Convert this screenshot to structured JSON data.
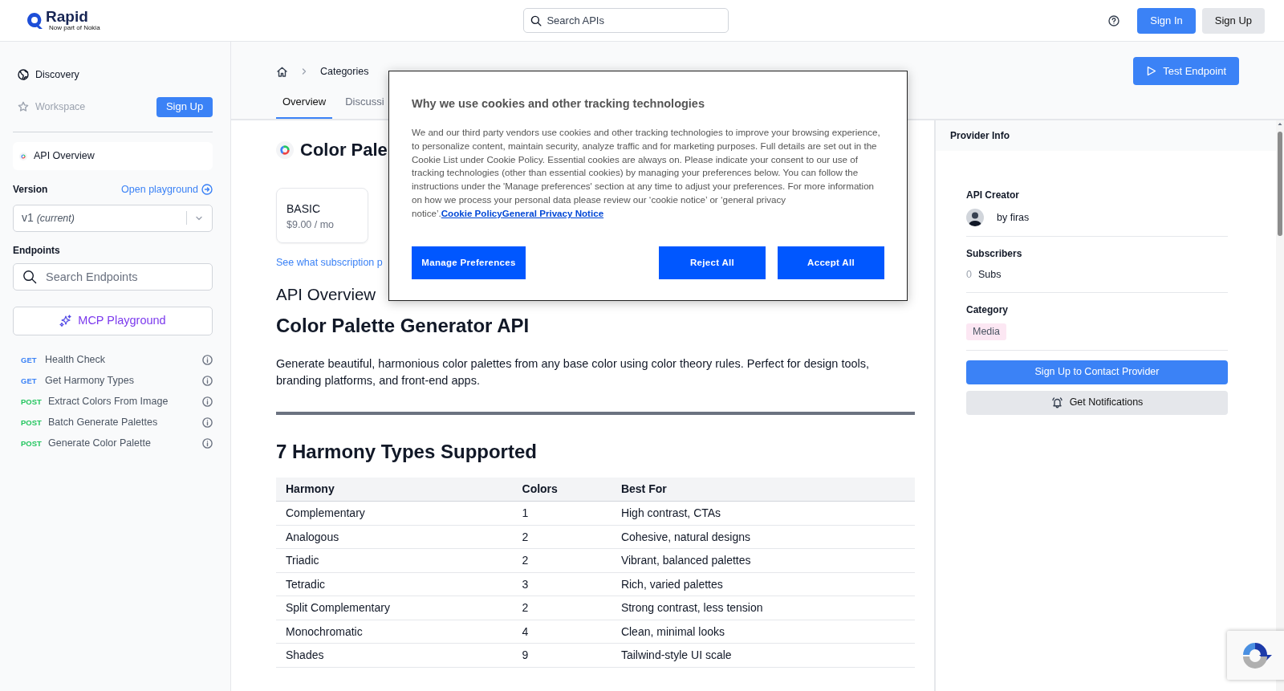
{
  "header": {
    "logo": "Rapid",
    "logo_tagline": "Now part of Nokia",
    "search": {
      "placeholder": "Search APIs"
    },
    "buttons": [
      {
        "label": "Sign In",
        "kind": "primary"
      },
      {
        "label": "Sign Up",
        "kind": "secondary"
      }
    ]
  },
  "sidebar": {
    "nav": [
      {
        "label": "Discovery",
        "kind": "globe",
        "disabled": false
      },
      {
        "label": "Workspace",
        "kind": "star",
        "disabled": true
      }
    ],
    "signup_button": "Sign Up",
    "api_overview": {
      "label": "API Overview",
      "selected": true
    },
    "version": {
      "label": "Version",
      "playground_link": "Open playground",
      "value": "v1",
      "note": "(current)"
    },
    "endpoints": {
      "label": "Endpoints",
      "search": {
        "placeholder": "Search Endpoints"
      },
      "mcp_button": "MCP Playground",
      "items": [
        {
          "method": "GET",
          "name": "Health Check",
          "color": "#3b82f6"
        },
        {
          "method": "GET",
          "name": "Get Harmony Types",
          "color": "#3b82f6"
        },
        {
          "method": "POST",
          "name": "Extract Colors From Image",
          "color": "#22c55e"
        },
        {
          "method": "POST",
          "name": "Batch Generate Palettes",
          "color": "#22c55e"
        },
        {
          "method": "POST",
          "name": "Generate Color Palette",
          "color": "#22c55e"
        }
      ]
    }
  },
  "breadcrumb": [
    "Categories"
  ],
  "tabs": [
    {
      "label": "Overview",
      "selected": true
    },
    {
      "label": "Discussi",
      "selected": false
    }
  ],
  "test_button": "Test Endpoint",
  "api": {
    "title": "Color Pale",
    "plans": [
      {
        "name": "BASIC",
        "price": "$9.00 / mo"
      }
    ],
    "plans_link": "See what subscription p",
    "overview_heading": "API Overview",
    "name_heading": "Color Palette Generator API",
    "description": "Generate beautiful, harmonious color palettes from any base color using color theory rules. Perfect for design tools, branding platforms, and front-end apps.",
    "section_heading": "7 Harmony Types Supported",
    "table": {
      "columns": [
        "Harmony",
        "Colors",
        "Best For"
      ],
      "rows": [
        [
          "Complementary",
          "1",
          "High contrast, CTAs"
        ],
        [
          "Analogous",
          "2",
          "Cohesive, natural designs"
        ],
        [
          "Triadic",
          "2",
          "Vibrant, balanced palettes"
        ],
        [
          "Tetradic",
          "3",
          "Rich, varied palettes"
        ],
        [
          "Split Complementary",
          "2",
          "Strong contrast, less tension"
        ],
        [
          "Monochromatic",
          "4",
          "Clean, minimal looks"
        ],
        [
          "Shades",
          "9",
          "Tailwind-style UI scale"
        ]
      ]
    }
  },
  "provider": {
    "title": "Provider Info",
    "creator_label": "API Creator",
    "creator": "by firas",
    "subscribers_label": "Subscribers",
    "subscribers_count": "0",
    "subscribers_unit": "Subs",
    "category_label": "Category",
    "category": "Media",
    "contact_button": "Sign Up to Contact Provider",
    "notify_button": "Get Notifications"
  },
  "cookie_dialog": {
    "title": "Why we use cookies and other tracking technologies",
    "body": "We and our third party vendors use cookies and other tracking technologies to improve your browsing experience, to personalize content, maintain security, analyze traffic and for marketing purposes. Full details are set out in the Cookie List under Cookie Policy. Essential cookies are always on. Please indicate your consent to our use of tracking technologies (other than essential cookies) by managing your preferences below. You can follow the instructions under the 'Manage preferences' section at any time to adjust your preferences. For more information on how we process your personal data please review our ‘cookie notice’ or ‘general privacy notice’.",
    "links": [
      "Cookie Policy",
      "General Privacy Notice"
    ],
    "buttons": [
      {
        "label": "Manage Preferences"
      },
      {
        "label": "Reject All"
      },
      {
        "label": "Accept All"
      }
    ]
  }
}
